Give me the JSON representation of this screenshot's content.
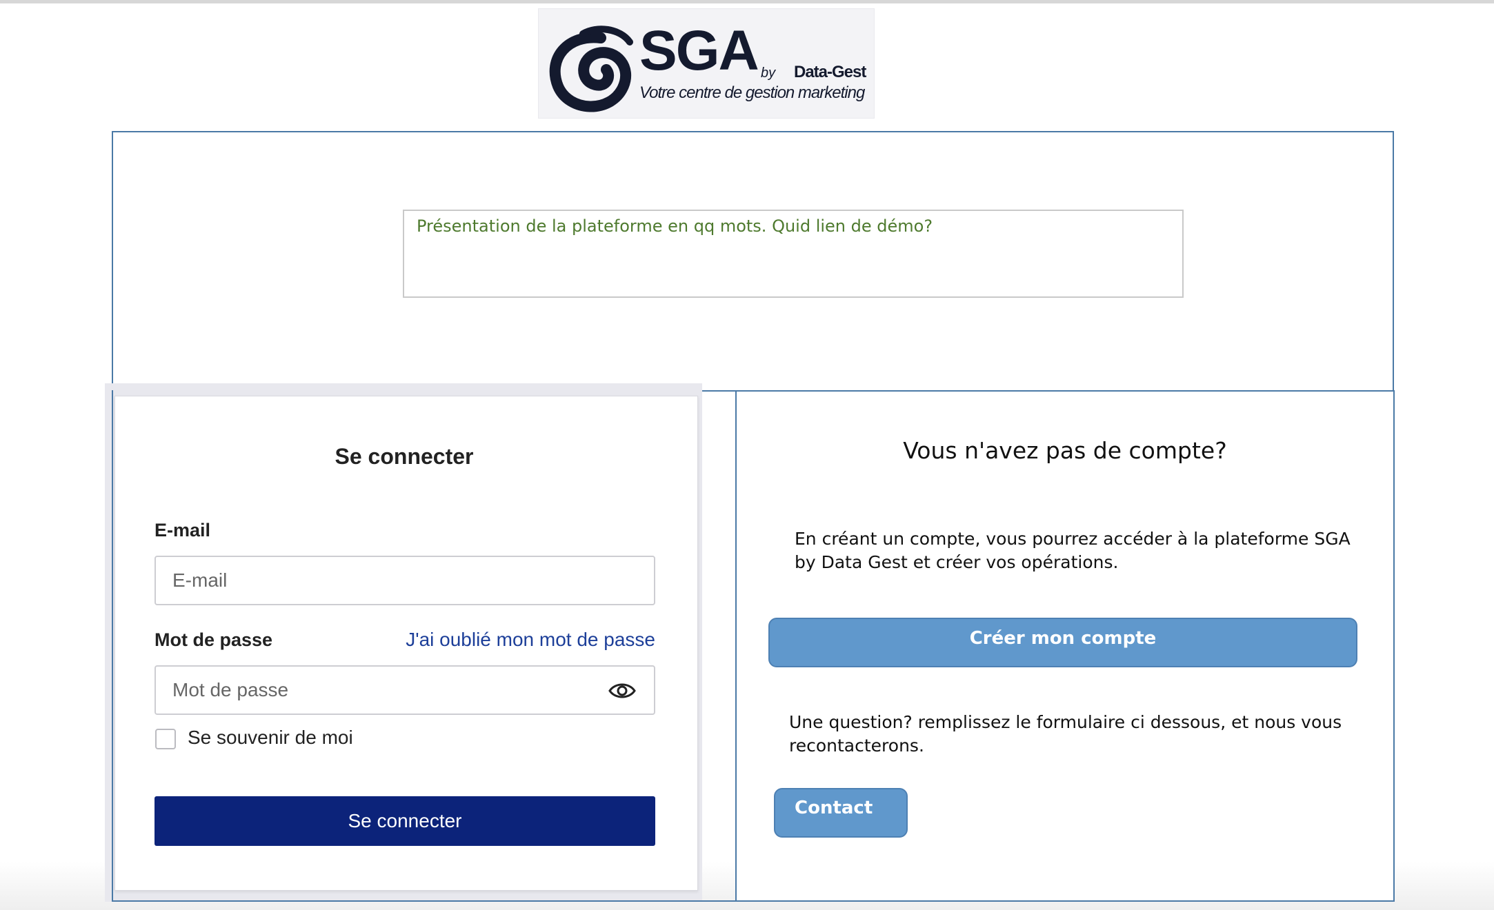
{
  "logo": {
    "name": "SGA",
    "by": "by",
    "company": "Data-Gest",
    "tagline": "Votre centre de gestion marketing"
  },
  "presentation": {
    "text": "Présentation de la plateforme en qq mots. Quid lien de démo?"
  },
  "login": {
    "title": "Se connecter",
    "email_label": "E-mail",
    "email_placeholder": "E-mail",
    "password_label": "Mot de passe",
    "password_placeholder": "Mot de passe",
    "forgot_link": "J'ai oublié mon mot de passe",
    "remember_label": "Se souvenir de moi",
    "remember_checked": false,
    "submit_label": "Se connecter"
  },
  "signup": {
    "title": "Vous n'avez pas de compte?",
    "description_line1": "En créant un compte, vous pourrez accéder à la plateforme SGA",
    "description_line2": "by Data Gest et créer vos opérations.",
    "create_button": "Créer mon compte",
    "question_line1": "Une question? remplissez le formulaire ci dessous, et nous vous",
    "question_line2": "recontacterons.",
    "contact_button": "Contact"
  },
  "colors": {
    "primary_button": "#0c237a",
    "secondary_button": "#6098cc",
    "frame_border": "#4a79a6",
    "presentation_text": "#4e7a2e",
    "link": "#1d3f99"
  },
  "icons": {
    "password_toggle": "eye-icon",
    "logo_mark": "swirl-logo-icon"
  }
}
